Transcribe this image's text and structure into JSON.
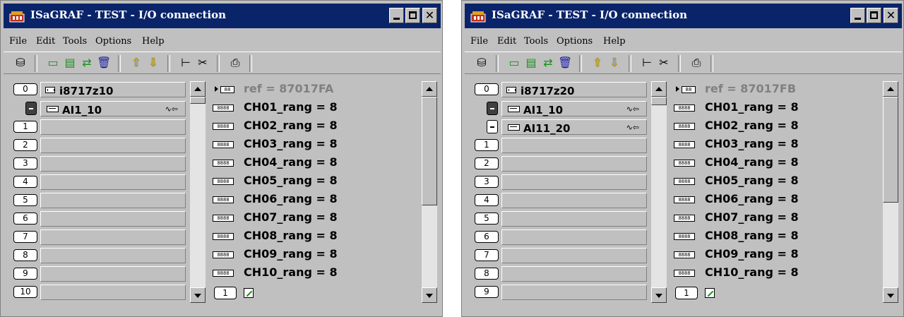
{
  "windows": [
    {
      "title": "ISaGRAF - TEST - I/O connection",
      "menu": [
        "File",
        "Edit",
        "Tools",
        "Options",
        "Help"
      ],
      "board": {
        "slot": "0",
        "name": "i8717z10"
      },
      "devices": [
        {
          "name": "AI1_10",
          "selected": true
        }
      ],
      "empty_slots": [
        "1",
        "2",
        "3",
        "4",
        "5",
        "6",
        "7",
        "8",
        "9",
        "10"
      ],
      "ref": "ref = 87017FA",
      "channels": [
        "CH01_rang = 8",
        "CH02_rang = 8",
        "CH03_rang = 8",
        "CH04_rang = 8",
        "CH05_rang = 8",
        "CH06_rang = 8",
        "CH07_rang = 8",
        "CH08_rang = 8",
        "CH09_rang = 8",
        "CH10_rang = 8"
      ],
      "page": "1"
    },
    {
      "title": "ISaGRAF - TEST - I/O connection",
      "menu": [
        "File",
        "Edit",
        "Tools",
        "Options",
        "Help"
      ],
      "board": {
        "slot": "0",
        "name": "i8717z20"
      },
      "devices": [
        {
          "name": "AI1_10",
          "selected": true
        },
        {
          "name": "AI11_20",
          "selected": false
        }
      ],
      "empty_slots": [
        "1",
        "2",
        "3",
        "4",
        "5",
        "6",
        "7",
        "8",
        "9"
      ],
      "ref": "ref = 87017FB",
      "channels": [
        "CH01_rang = 8",
        "CH02_rang = 8",
        "CH03_rang = 8",
        "CH04_rang = 8",
        "CH05_rang = 8",
        "CH06_rang = 8",
        "CH07_rang = 8",
        "CH08_rang = 8",
        "CH09_rang = 8",
        "CH10_rang = 8"
      ],
      "page": "1"
    }
  ],
  "icons": {
    "toolbar": [
      "open-board-icon",
      "connect-icon",
      "disconnect-icon",
      "info-icon",
      "delete-icon",
      "move-up-icon",
      "move-down-icon",
      "tree-icon",
      "cut-icon",
      "print-icon"
    ],
    "channel": "channel-param-icon",
    "device": "device-icon",
    "board": "board-icon",
    "direction": "input-direction-icon",
    "edit": "edit-icon"
  },
  "colors": {
    "titlebar": "#0a246a",
    "face": "#c0c0c0",
    "ref_text": "#808080"
  }
}
